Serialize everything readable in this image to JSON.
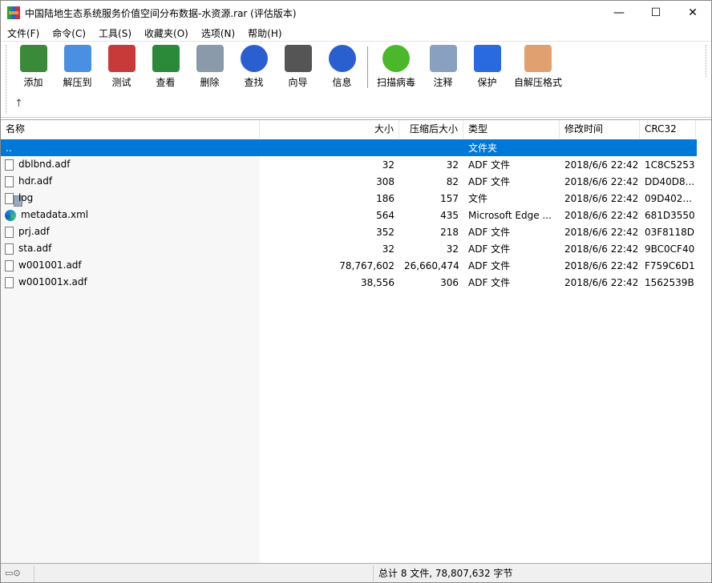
{
  "window": {
    "title": "中国陆地生态系统服务价值空间分布数据-水资源.rar (评估版本)",
    "min": "—",
    "max": "☐",
    "close": "✕"
  },
  "menu": [
    "文件(F)",
    "命令(C)",
    "工具(S)",
    "收藏夹(O)",
    "选项(N)",
    "帮助(H)"
  ],
  "toolbar": [
    {
      "label": "添加",
      "icon": "add-archive-icon",
      "color": "#3a8a3a"
    },
    {
      "label": "解压到",
      "icon": "extract-folder-icon",
      "color": "#4a90e2"
    },
    {
      "label": "测试",
      "icon": "test-clipboard-icon",
      "color": "#c83a3a"
    },
    {
      "label": "查看",
      "icon": "view-book-icon",
      "color": "#2a8a3a"
    },
    {
      "label": "删除",
      "icon": "trash-icon",
      "color": "#8a9aaa"
    },
    {
      "label": "查找",
      "icon": "search-magnifier-icon",
      "color": "#2a5fd0"
    },
    {
      "label": "向导",
      "icon": "wizard-wand-icon",
      "color": "#555555"
    },
    {
      "label": "信息",
      "icon": "info-icon",
      "color": "#2a5fd0"
    },
    {
      "label": "扫描病毒",
      "icon": "virus-scan-icon",
      "color": "#4ab82a"
    },
    {
      "label": "注释",
      "icon": "comment-icon",
      "color": "#8aa0c0"
    },
    {
      "label": "保护",
      "icon": "shield-icon",
      "color": "#2a6ae0"
    },
    {
      "label": "自解压格式",
      "icon": "sfx-box-icon",
      "color": "#e0a070"
    }
  ],
  "up_arrow": "↑",
  "columns": [
    "名称",
    "大小",
    "压缩后大小",
    "类型",
    "修改时间",
    "CRC32"
  ],
  "files": [
    {
      "name": "..",
      "size": "",
      "packed": "",
      "type": "文件夹",
      "mtime": "",
      "crc": "",
      "icon": "up"
    },
    {
      "name": "dblbnd.adf",
      "size": "32",
      "packed": "32",
      "type": "ADF 文件",
      "mtime": "2018/6/6 22:42",
      "crc": "1C8C5253",
      "icon": "file"
    },
    {
      "name": "hdr.adf",
      "size": "308",
      "packed": "82",
      "type": "ADF 文件",
      "mtime": "2018/6/6 22:42",
      "crc": "DD40D8...",
      "icon": "file"
    },
    {
      "name": "log",
      "size": "186",
      "packed": "157",
      "type": "文件",
      "mtime": "2018/6/6 22:42",
      "crc": "09D402...",
      "icon": "file"
    },
    {
      "name": "metadata.xml",
      "size": "564",
      "packed": "435",
      "type": "Microsoft Edge ...",
      "mtime": "2018/6/6 22:42",
      "crc": "681D3550",
      "icon": "edge"
    },
    {
      "name": "prj.adf",
      "size": "352",
      "packed": "218",
      "type": "ADF 文件",
      "mtime": "2018/6/6 22:42",
      "crc": "03F8118D",
      "icon": "file"
    },
    {
      "name": "sta.adf",
      "size": "32",
      "packed": "32",
      "type": "ADF 文件",
      "mtime": "2018/6/6 22:42",
      "crc": "9BC0CF40",
      "icon": "file"
    },
    {
      "name": "w001001.adf",
      "size": "78,767,602",
      "packed": "26,660,474",
      "type": "ADF 文件",
      "mtime": "2018/6/6 22:42",
      "crc": "F759C6D1",
      "icon": "file"
    },
    {
      "name": "w001001x.adf",
      "size": "38,556",
      "packed": "306",
      "type": "ADF 文件",
      "mtime": "2018/6/6 22:42",
      "crc": "1562539B",
      "icon": "file"
    }
  ],
  "status": {
    "summary": "总计 8 文件, 78,807,632 字节",
    "icons": "▭⊙"
  }
}
